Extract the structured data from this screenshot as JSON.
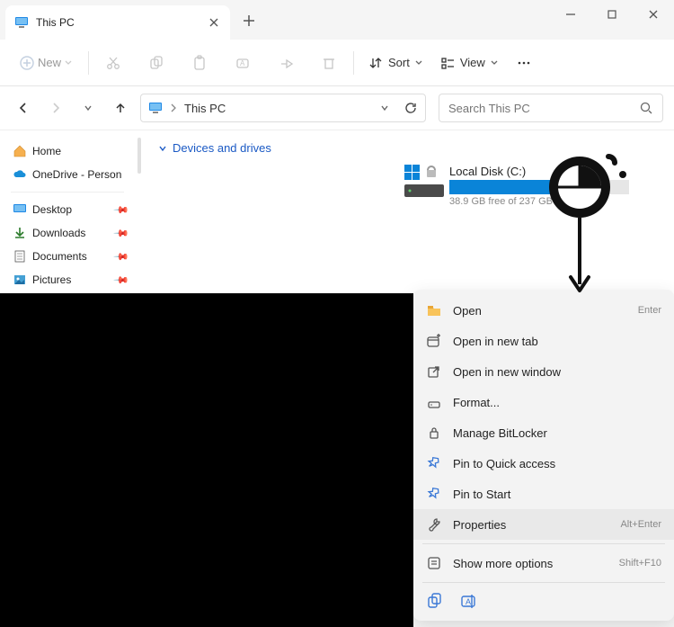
{
  "titlebar": {
    "tab_title": "This PC"
  },
  "toolbar": {
    "new_label": "New",
    "sort_label": "Sort",
    "view_label": "View"
  },
  "navbar": {
    "breadcrumb": "This PC"
  },
  "search": {
    "placeholder": "Search This PC"
  },
  "sidebar": {
    "home": "Home",
    "onedrive": "OneDrive - Person",
    "desktop": "Desktop",
    "downloads": "Downloads",
    "documents": "Documents",
    "pictures": "Pictures"
  },
  "content": {
    "section": "Devices and drives",
    "drive": {
      "name": "Local Disk (C:)",
      "free": "38.9 GB free of 237 GB"
    }
  },
  "ctx": {
    "open": "Open",
    "open_shortcut": "Enter",
    "open_tab": "Open in new tab",
    "open_window": "Open in new window",
    "format": "Format...",
    "bitlocker": "Manage BitLocker",
    "pin_quick": "Pin to Quick access",
    "pin_start": "Pin to Start",
    "properties": "Properties",
    "properties_shortcut": "Alt+Enter",
    "more": "Show more options",
    "more_shortcut": "Shift+F10"
  }
}
